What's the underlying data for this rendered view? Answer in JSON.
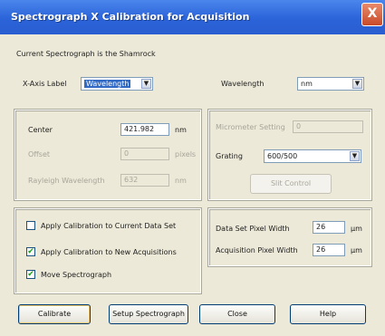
{
  "window": {
    "title": "Spectrograph X Calibration for Acquisition",
    "close_glyph": "X"
  },
  "info": {
    "current_spectrograph": "Current Spectrograph is the Shamrock"
  },
  "xaxis": {
    "label_caption": "X-Axis Label",
    "label_value": "Wavelength",
    "unit_caption": "Wavelength",
    "unit_value": "nm"
  },
  "center_group": {
    "center_label": "Center",
    "center_value": "421.982",
    "center_unit": "nm",
    "offset_label": "Offset",
    "offset_value": "0",
    "offset_unit": "pixels",
    "rayleigh_label": "Rayleigh Wavelength",
    "rayleigh_value": "632",
    "rayleigh_unit": "nm"
  },
  "grating_group": {
    "micrometer_label": "Micrometer Setting",
    "micrometer_value": "0",
    "grating_label": "Grating",
    "grating_value": "600/500",
    "slit_button": "Slit Control"
  },
  "options": {
    "apply_current": {
      "label": "Apply Calibration to Current Data Set",
      "checked": false
    },
    "apply_new": {
      "label": "Apply Calibration to New Acquisitions",
      "checked": true
    },
    "move_spectrograph": {
      "label": "Move Spectrograph",
      "checked": true
    },
    "check_glyph": "✔"
  },
  "pixel_group": {
    "dataset_label": "Data Set Pixel Width",
    "dataset_value": "26",
    "dataset_unit": "μm",
    "acq_label": "Acquisition Pixel Width",
    "acq_value": "26",
    "acq_unit": "μm"
  },
  "buttons": {
    "calibrate": "Calibrate",
    "setup": "Setup Spectrograph",
    "close": "Close",
    "help": "Help"
  },
  "colors": {
    "titlebar": "#2b63d9",
    "dialog_bg": "#ece9d8",
    "selection": "#316ac5"
  }
}
